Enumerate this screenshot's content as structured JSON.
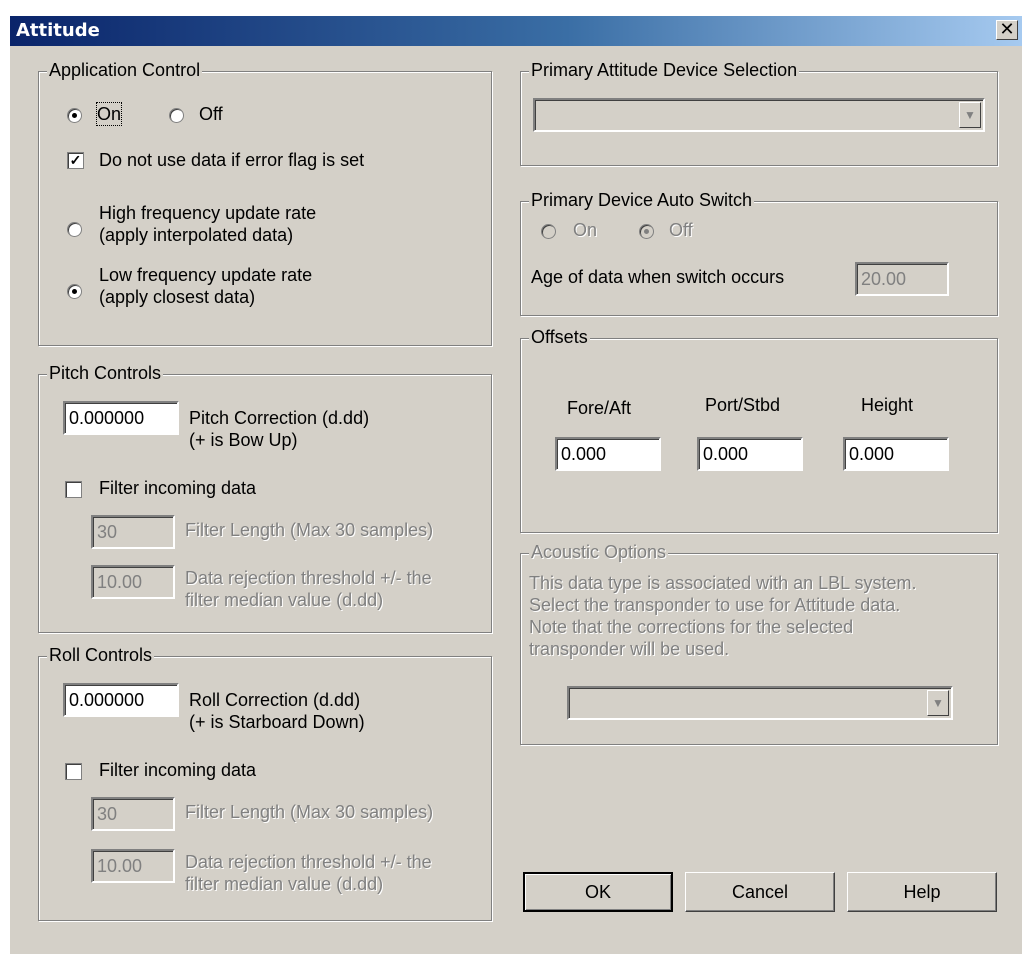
{
  "window": {
    "title": "Attitude"
  },
  "app_control": {
    "legend": "Application Control",
    "on_label": "On",
    "off_label": "Off",
    "selected": "On",
    "error_flag_label": "Do not use data if error flag is set",
    "error_flag_checked": true,
    "high_freq_label_1": "High frequency update rate",
    "high_freq_label_2": "(apply interpolated data)",
    "low_freq_label_1": "Low frequency update rate",
    "low_freq_label_2": "(apply closest data)",
    "update_rate_selected": "Low"
  },
  "pitch": {
    "legend": "Pitch Controls",
    "correction_value": "0.000000",
    "correction_label_1": "Pitch Correction (d.dd)",
    "correction_label_2": "(+ is Bow Up)",
    "filter_label": "Filter incoming data",
    "filter_checked": false,
    "filter_length_value": "30",
    "filter_length_label": "Filter Length (Max 30 samples)",
    "threshold_value": "10.00",
    "threshold_label_1": "Data rejection threshold +/- the",
    "threshold_label_2": "filter median value (d.dd)"
  },
  "roll": {
    "legend": "Roll Controls",
    "correction_value": "0.000000",
    "correction_label_1": "Roll Correction (d.dd)",
    "correction_label_2": "(+ is Starboard Down)",
    "filter_label": "Filter incoming data",
    "filter_checked": false,
    "filter_length_value": "30",
    "filter_length_label": "Filter Length (Max 30 samples)",
    "threshold_value": "10.00",
    "threshold_label_1": "Data rejection threshold +/- the",
    "threshold_label_2": "filter median value (d.dd)"
  },
  "device_selection": {
    "legend": "Primary Attitude Device Selection",
    "value": ""
  },
  "auto_switch": {
    "legend": "Primary Device Auto Switch",
    "on_label": "On",
    "off_label": "Off",
    "selected": "Off",
    "age_label": "Age of data when switch occurs",
    "age_value": "20.00"
  },
  "offsets": {
    "legend": "Offsets",
    "fore_aft_label": "Fore/Aft",
    "port_stbd_label": "Port/Stbd",
    "height_label": "Height",
    "fore_aft_value": "0.000",
    "port_stbd_value": "0.000",
    "height_value": "0.000"
  },
  "acoustic": {
    "legend": "Acoustic Options",
    "line_1": "This data type is associated with an LBL system.",
    "line_2": "Select the transponder to use for Attitude data.",
    "line_3": "Note that the corrections for the selected",
    "line_4": "transponder will be used.",
    "transponder_value": ""
  },
  "buttons": {
    "ok": "OK",
    "cancel": "Cancel",
    "help": "Help"
  },
  "icons": {
    "close": "close-icon",
    "dropdown": "chevron-down-icon"
  }
}
